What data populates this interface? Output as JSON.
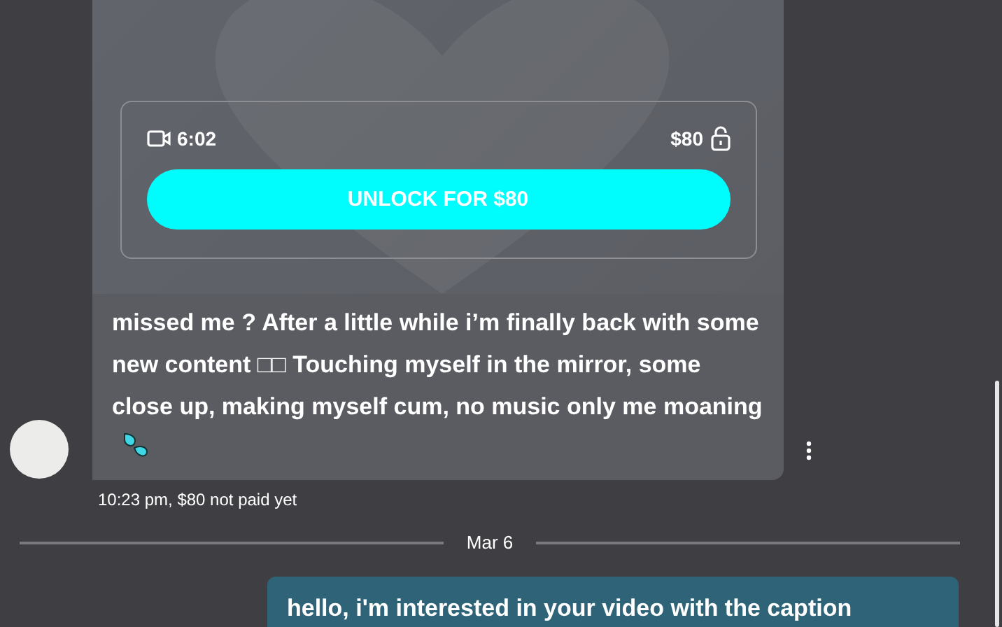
{
  "incoming_message": {
    "media": {
      "kind": "video",
      "duration": "6:02",
      "price": "$80",
      "locked": true,
      "unlock_button": "UNLOCK FOR $80"
    },
    "text": "missed me ? After a little while i’m finally back with some new content □□ Touching myself in the mirror, some close up, making myself cum, no music only me moaning",
    "meta": "10:23 pm,  $80 not paid yet"
  },
  "date_divider": "Mar 6",
  "outgoing_message": {
    "text": "hello, i'm interested in your video with the caption"
  }
}
